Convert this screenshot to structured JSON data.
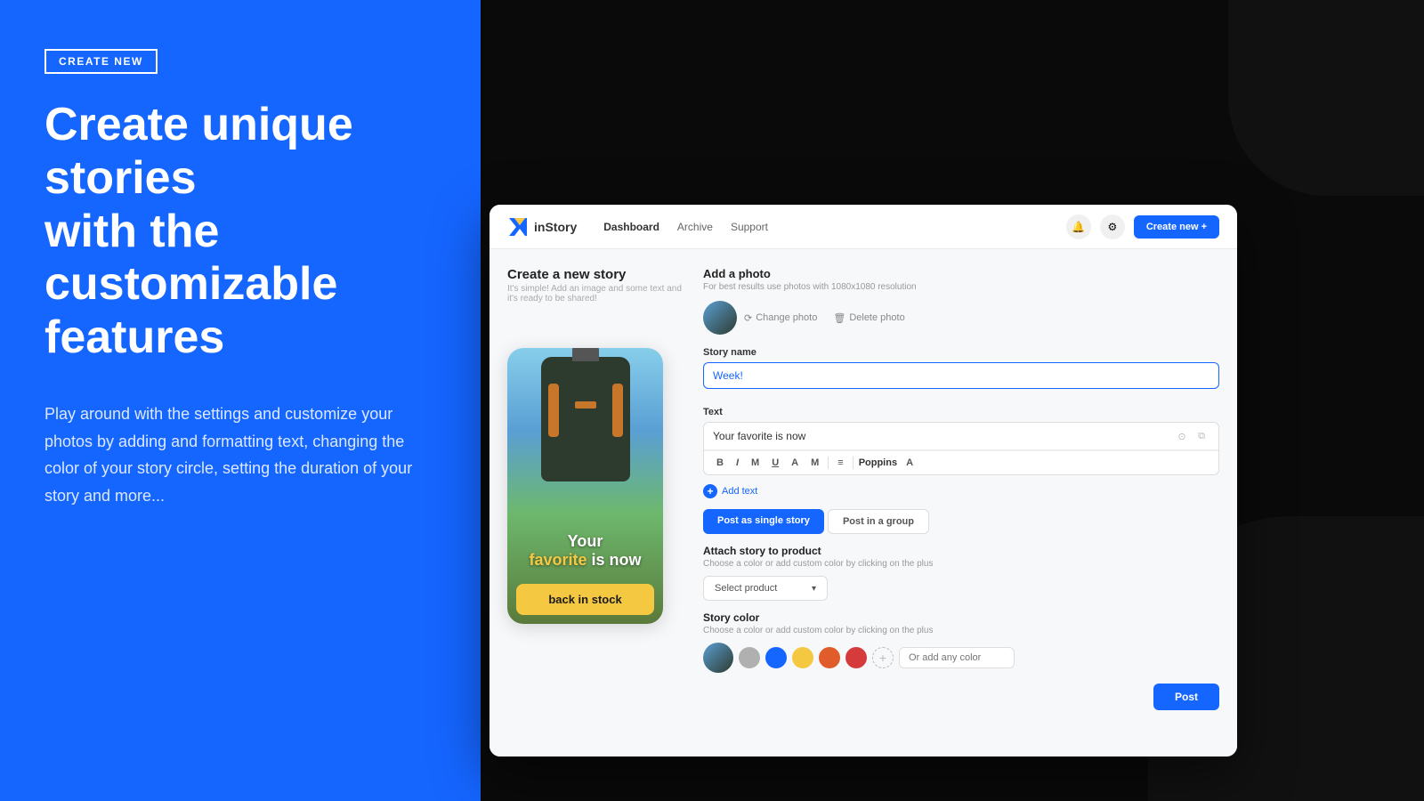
{
  "badge": "CREATE NEW",
  "heading_line1": "Create unique stories",
  "heading_line2": "with the customizable",
  "heading_line3": "features",
  "subtext": "Play around with the settings and customize your photos by adding and formatting text, changing the color of your story circle, setting the duration of your story and more...",
  "colors": {
    "blue": "#1565ff",
    "black": "#0a0a0a",
    "white": "#ffffff",
    "yellow": "#f5c842"
  },
  "app": {
    "logo": "inStory",
    "nav": {
      "items": [
        "Dashboard",
        "Archive",
        "Support"
      ]
    },
    "create_btn": "Create new +",
    "page_title": "Create a new story",
    "page_sub": "It's simple! Add an image and some text and it's ready to be shared!",
    "photo_section": {
      "title": "Add a photo",
      "sub": "For best results use photos with 1080x1080 resolution",
      "change_label": "Change photo",
      "delete_label": "Delete photo"
    },
    "story_name_label": "Story name",
    "story_name_value": "Week!",
    "text_label": "Text",
    "text_value": "Your favorite is now",
    "formatting": {
      "bold": "B",
      "italic": "I",
      "mono": "M",
      "underline": "U",
      "strikethrough": "A",
      "size": "M",
      "align": "≡",
      "font": "Poppins",
      "size2": "A"
    },
    "add_text_label": "Add text",
    "post_tabs": [
      "Post as single story",
      "Post in a group"
    ],
    "attach_title": "Attach story to product",
    "attach_sub": "Choose a color or add custom color by clicking on the plus",
    "select_product_label": "Select product",
    "story_color_title": "Story color",
    "story_color_sub": "Choose a color or add custom color by clicking on the plus",
    "color_swatches": [
      "#b0b0b0",
      "#1565ff",
      "#f5c842",
      "#e05c2a",
      "#d63b3b"
    ],
    "color_input_placeholder": "Or add any color",
    "post_btn": "Post"
  },
  "phone": {
    "text_line1": "Your",
    "text_highlight": "favorite",
    "text_suffix": "is now",
    "text_line2": "back in stock"
  }
}
